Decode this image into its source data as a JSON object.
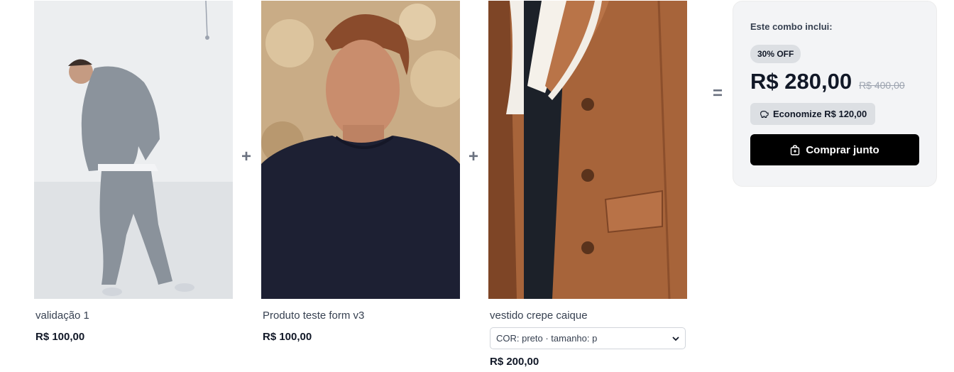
{
  "products": [
    {
      "name": "validação 1",
      "price": "R$ 100,00",
      "image": "grey-tracksuit-photo"
    },
    {
      "name": "Produto teste form v3",
      "price": "R$ 100,00",
      "image": "navy-tshirt-photo"
    },
    {
      "name": "vestido crepe caique",
      "price": "R$ 200,00",
      "image": "brown-shearling-jacket-photo",
      "variant_selected": "COR: preto · tamanho: p"
    }
  ],
  "operators": {
    "plus": "+",
    "equals": "="
  },
  "combo": {
    "heading": "Este combo inclui:",
    "discount_badge": "30% OFF",
    "price_now": "R$ 280,00",
    "price_old": "R$ 400,00",
    "savings": "Economize R$ 120,00",
    "buy_label": "Comprar junto",
    "savings_icon": "piggy-bank-icon",
    "buy_icon": "shopping-bag-icon"
  },
  "colors": {
    "buy_button": "#000000",
    "panel_bg": "#f3f4f6",
    "badge_bg": "#dcdfe3"
  }
}
